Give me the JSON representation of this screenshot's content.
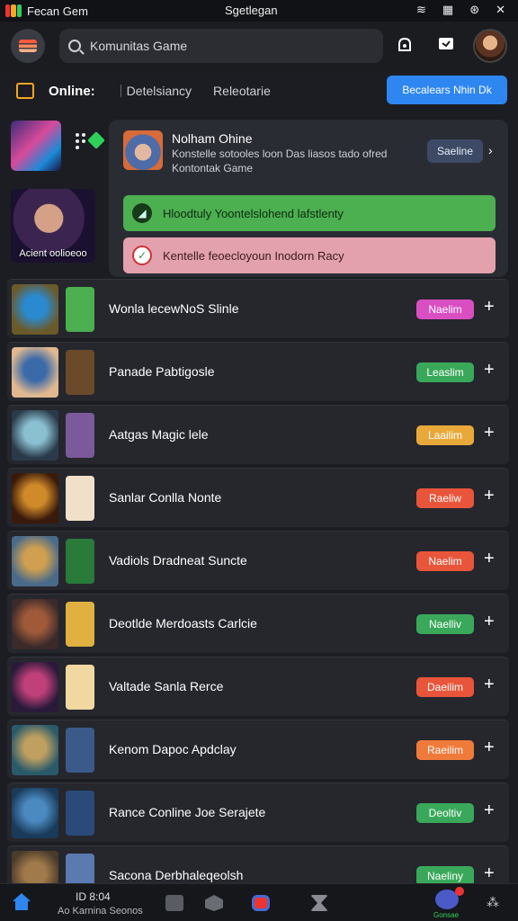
{
  "status_bar": {
    "left_title": "Fecan Gem",
    "center_title": "Sgetlegan",
    "right_icons": [
      "wifi-icon",
      "grid-icon",
      "sync-icon",
      "close-icon"
    ],
    "right_glyphs": [
      "≋",
      "▦",
      "⊛",
      "✕"
    ]
  },
  "header": {
    "search_placeholder": "Komunitas Game",
    "icons": [
      "notification-icon",
      "chat-icon",
      "profile-avatar"
    ]
  },
  "subnav": {
    "online_label": "Online:",
    "tab2": "Detelsiancy",
    "tab3": "Releotarie",
    "cta_label": "Becalears Nhin Dk"
  },
  "left_panel": {
    "avatar_caption": "Acient oolioeoo"
  },
  "feature_card": {
    "title": "Nolham Ohine",
    "line1": "Konstelle sotooles loon Das liasos tado ofred",
    "line2": "Kontontak Game",
    "button_label": "Saeline",
    "bar_green": "Hloodtuly Yoontelslohend lafstlenty",
    "bar_pink": "Kentelle feoecloyoun Inodorn Racy",
    "accent_green": "#4caf50",
    "accent_pink": "#e3a1ad"
  },
  "list": [
    {
      "name": "Wonla lecewNoS Slinle",
      "badge": "Naelim",
      "badge_color": "#d94fc2",
      "ic1": [
        "#6b5a2a",
        "#2a8ad0"
      ],
      "ic2": "#4caf50"
    },
    {
      "name": "Panade Pabtigosle",
      "badge": "Leaslim",
      "badge_color": "#3aa85a",
      "ic1": [
        "#e0b890",
        "#3a6aa8"
      ],
      "ic2": "#6a4a2a"
    },
    {
      "name": "Aatgas Magic lele",
      "badge": "Laailim",
      "badge_color": "#e8a93a",
      "ic1": [
        "#2a3a4a",
        "#8ac0d0"
      ],
      "ic2": "#7a5a9a"
    },
    {
      "name": "Sanlar Conlla Nonte",
      "badge": "Raeliw",
      "badge_color": "#e8553a",
      "ic1": [
        "#3a1a0a",
        "#d08a2a"
      ],
      "ic2": "#f0e0c8"
    },
    {
      "name": "Vadiols Dradneat Suncte",
      "badge": "Naelim",
      "badge_color": "#e8553a",
      "ic1": [
        "#4a6a8a",
        "#d0a050"
      ],
      "ic2": "#2a7a3a"
    },
    {
      "name": "Deotlde Merdoasts Carlcie",
      "badge": "Naelliv",
      "badge_color": "#3aa85a",
      "ic1": [
        "#3a2a2a",
        "#a05a3a"
      ],
      "ic2": "#e0b040"
    },
    {
      "name": "Valtade Sanla Rerce",
      "badge": "Daeilim",
      "badge_color": "#e8553a",
      "ic1": [
        "#2a1a3a",
        "#c0407a"
      ],
      "ic2": "#f0d8a0"
    },
    {
      "name": "Kenom Dapoc Apdclay",
      "badge": "Raeilim",
      "badge_color": "#f07a3a",
      "ic1": [
        "#2a5a6a",
        "#c0a060"
      ],
      "ic2": "#3a5a8a"
    },
    {
      "name": "Rance Conline Joe Serajete",
      "badge": "Deoltiv",
      "badge_color": "#3aa85a",
      "ic1": [
        "#1a3a5a",
        "#4a8ac0"
      ],
      "ic2": "#2a4a7a"
    },
    {
      "name": "Sacona Derbhaleqeolsh",
      "badge": "Naeliny",
      "badge_color": "#3aa85a",
      "ic1": [
        "#4a3a2a",
        "#a07a4a"
      ],
      "ic2": "#5a7ab0"
    }
  ],
  "bottom_nav": {
    "counter": "ID 8:04",
    "caption": "Ao Karnina Seonos",
    "game_label": "Gonsae"
  }
}
